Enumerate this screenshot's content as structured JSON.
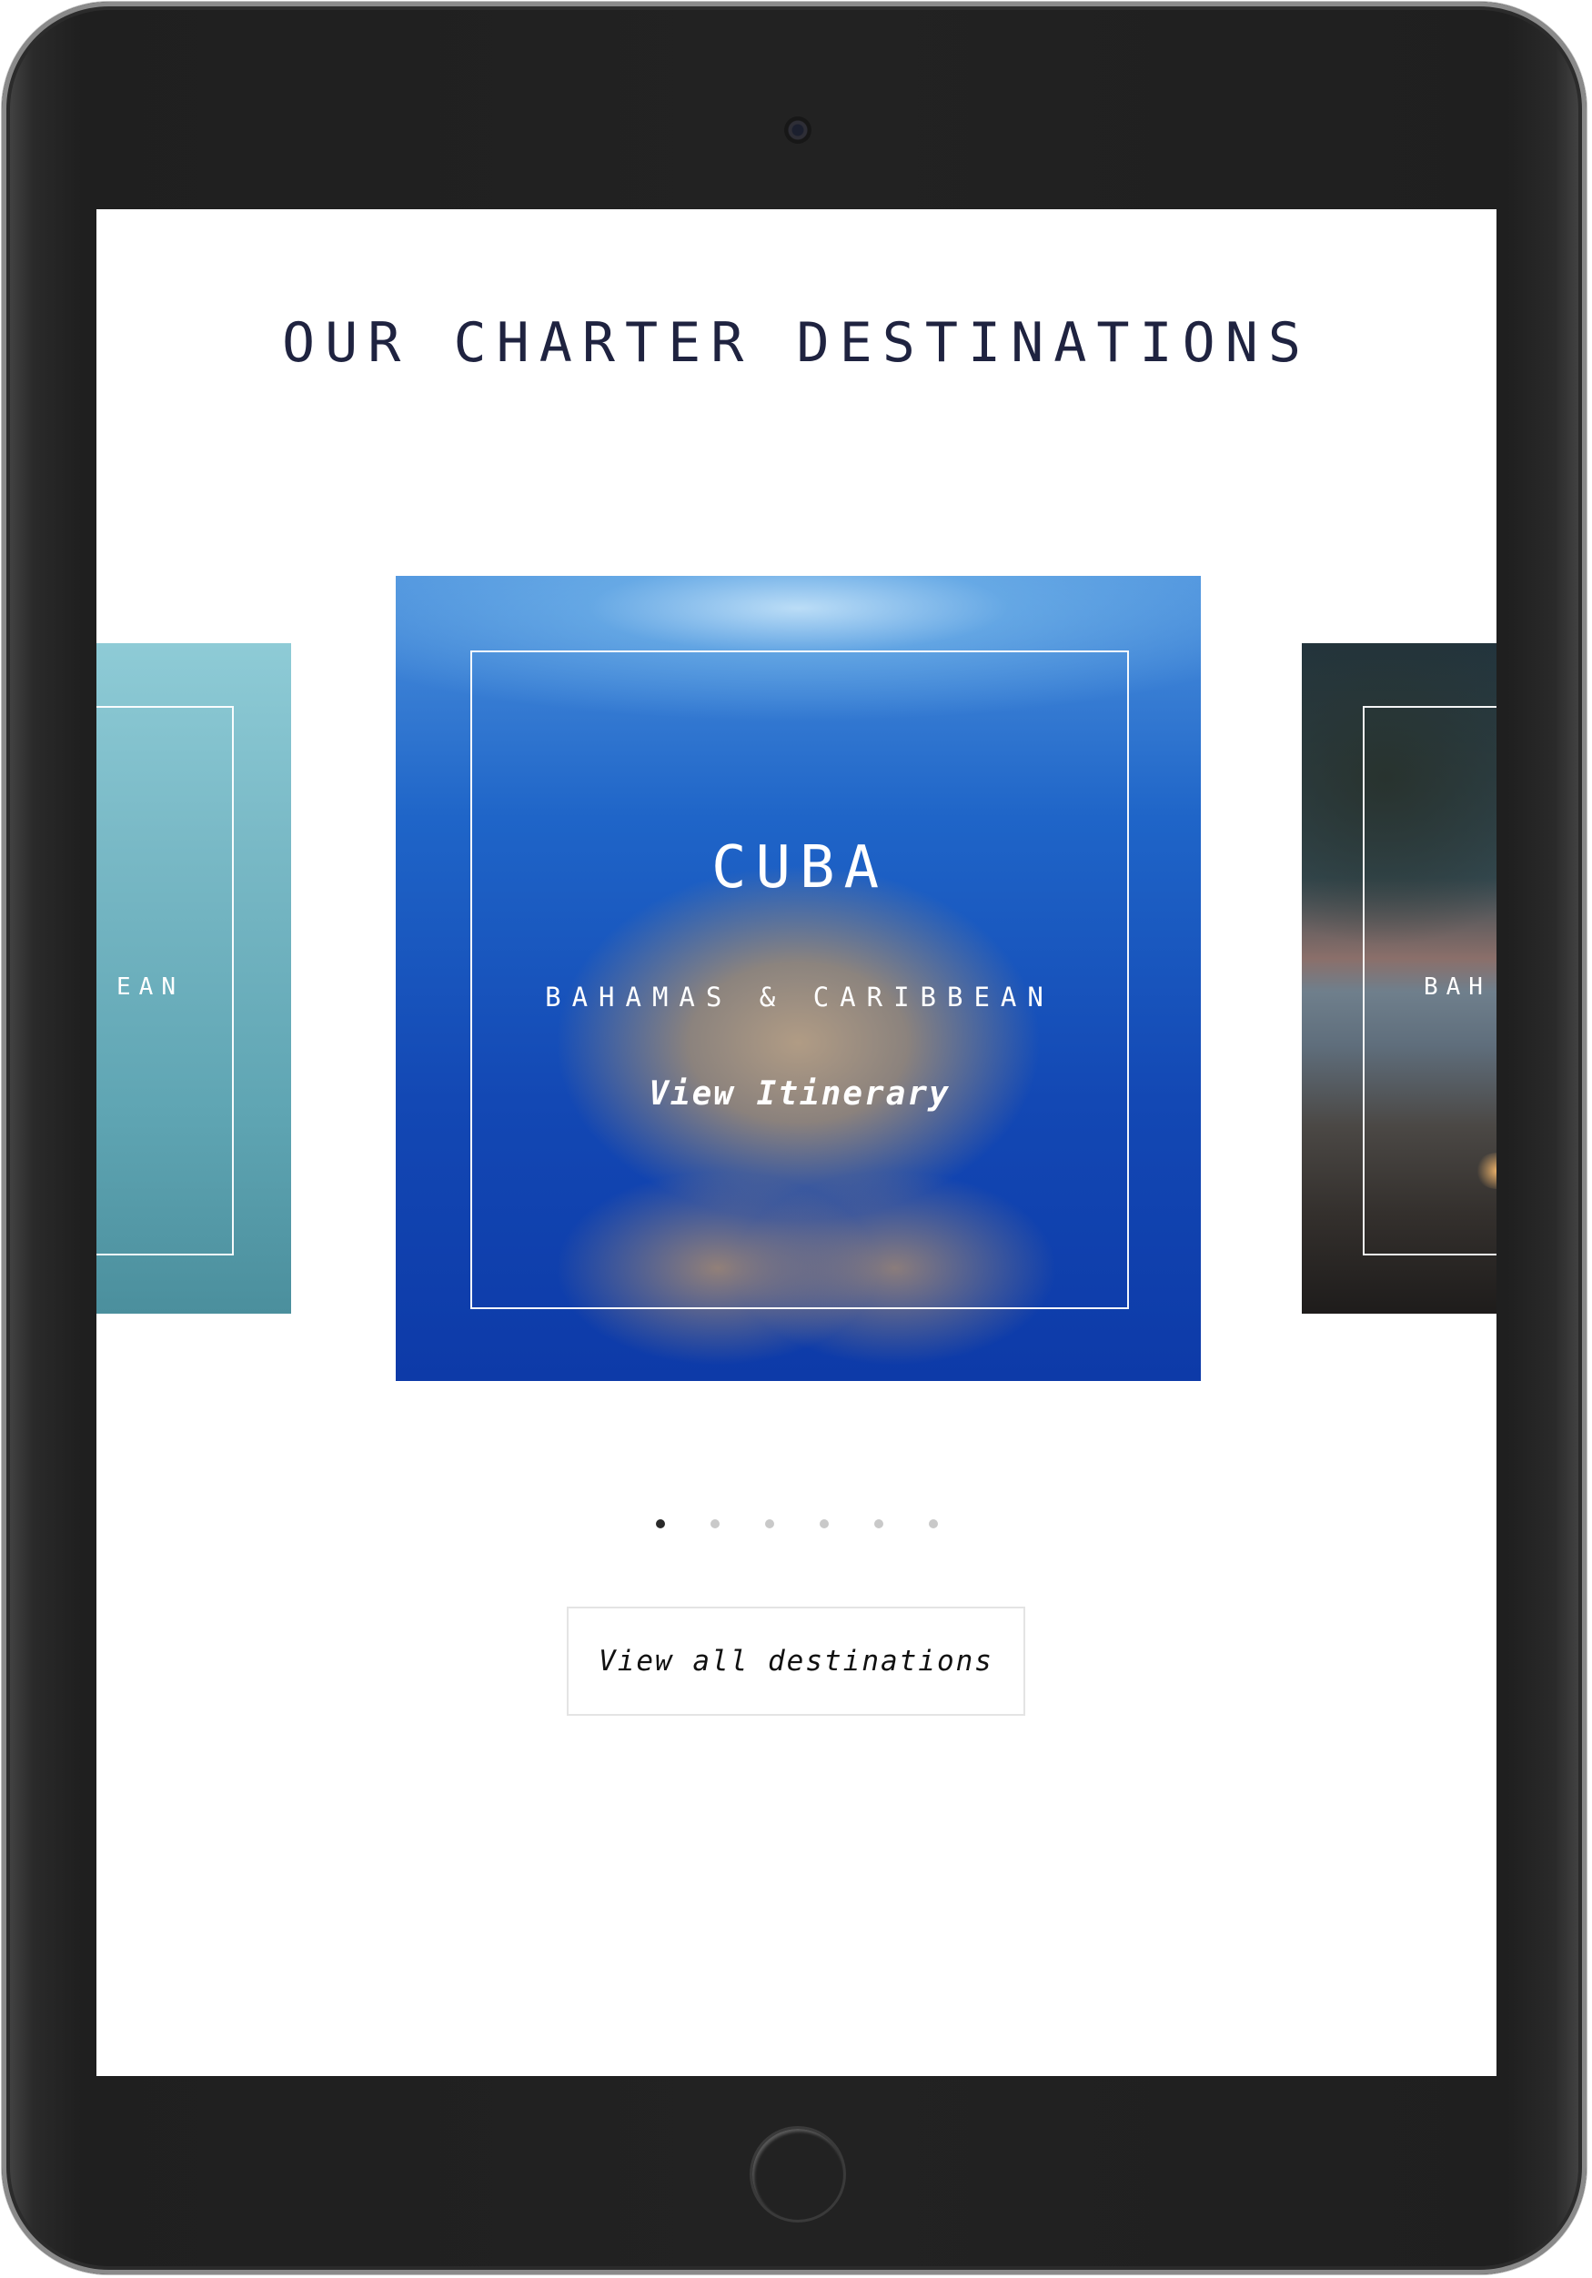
{
  "page": {
    "title": "OUR CHARTER DESTINATIONS"
  },
  "carousel": {
    "active_slide": {
      "title": "CUBA",
      "subtitle": "BAHAMAS & CARIBBEAN",
      "link_label": "View Itinerary"
    },
    "previous_slide": {
      "subtitle_fragment": "EAN"
    },
    "next_slide": {
      "subtitle_fragment": "BAH"
    },
    "dots_count": 6,
    "active_dot": 1
  },
  "cta": {
    "label": "View all destinations"
  },
  "colors": {
    "title": "#1f2340",
    "frame_border": "#ffffff",
    "button_border": "#e4e4e4",
    "dot_active": "#2a2a2a",
    "dot_inactive": "#c9c9c9"
  }
}
